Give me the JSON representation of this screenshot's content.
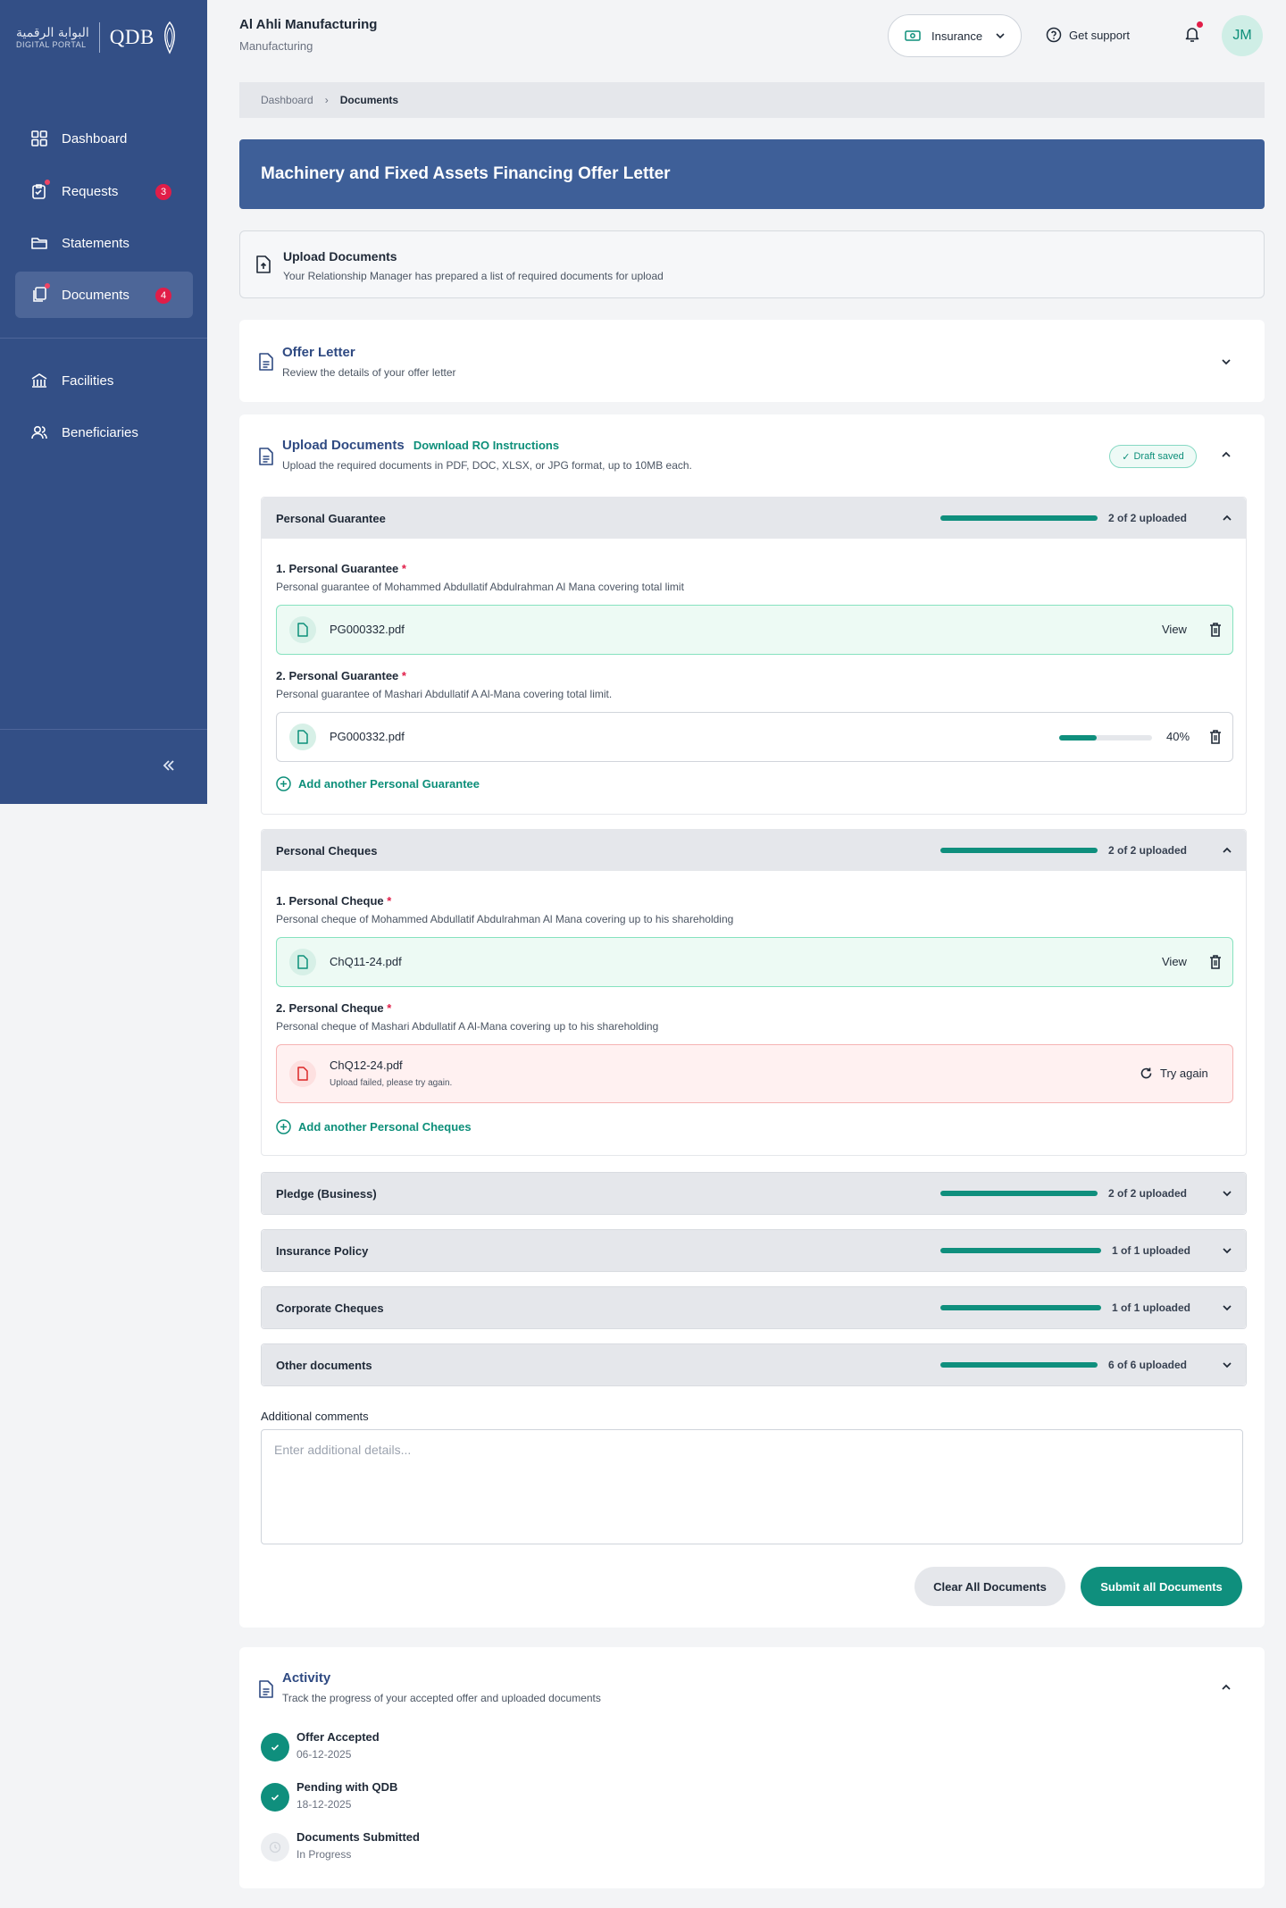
{
  "sidebar": {
    "logo_arabic": "البوابة الرقمية",
    "logo_english": "DIGITAL PORTAL",
    "logo_brand": "QDB",
    "items": [
      {
        "label": "Dashboard"
      },
      {
        "label": "Requests",
        "badge": "3"
      },
      {
        "label": "Statements"
      },
      {
        "label": "Documents",
        "badge": "4"
      },
      {
        "label": "Facilities"
      },
      {
        "label": "Beneficiaries"
      }
    ]
  },
  "header": {
    "company": "Al Ahli Manufacturing",
    "sector": "Manufacturing",
    "product_select": "Insurance",
    "support": "Get support",
    "avatar": "JM"
  },
  "breadcrumb": {
    "home": "Dashboard",
    "current": "Documents"
  },
  "page_title": "Machinery and Fixed Assets Financing Offer Letter",
  "upload_banner": {
    "title": "Upload Documents",
    "subtitle": "Your Relationship Manager has prepared a list of required documents for upload"
  },
  "offer_letter": {
    "title": "Offer Letter",
    "subtitle": "Review the details of your offer letter"
  },
  "upload_section": {
    "title": "Upload Documents",
    "link": "Download RO Instructions",
    "subtitle": "Upload the required documents in PDF, DOC, XLSX, or JPG format, up to 10MB each.",
    "draft": "Draft saved"
  },
  "sections": {
    "guarantee": {
      "title": "Personal Guarantee",
      "count": "2 of 2 uploaded",
      "progress": 1.0,
      "items": [
        {
          "title": "1. Personal Guarantee",
          "desc": "Personal guarantee of Mohammed Abdullatif Abdulrahman Al Mana covering total limit",
          "file": "PG000332.pdf",
          "action": "View"
        },
        {
          "title": "2. Personal Guarantee",
          "desc": "Personal guarantee of Mashari Abdullatif A Al-Mana covering total limit.",
          "file": "PG000332.pdf",
          "percent": "40%",
          "progress": 0.4
        }
      ],
      "add": "Add another Personal Guarantee"
    },
    "cheques": {
      "title": "Personal Cheques",
      "count": "2 of 2 uploaded",
      "progress": 1.0,
      "items": [
        {
          "title": "1. Personal Cheque",
          "desc": "Personal cheque of Mohammed Abdullatif Abdulrahman Al Mana covering up to his shareholding",
          "file": "ChQ11-24.pdf",
          "action": "View"
        },
        {
          "title": "2. Personal Cheque",
          "desc": "Personal cheque of Mashari Abdullatif A Al-Mana covering up to his shareholding",
          "file": "ChQ12-24.pdf",
          "error": "Upload failed, please try again.",
          "retry": "Try again"
        }
      ],
      "add": "Add another Personal Cheques"
    },
    "collapsed": [
      {
        "title": "Pledge (Business)",
        "count": "2 of 2 uploaded",
        "progress": 1.0
      },
      {
        "title": "Insurance Policy",
        "count": "1 of 1 uploaded",
        "progress": 1.0
      },
      {
        "title": "Corporate Cheques",
        "count": "1 of 1 uploaded",
        "progress": 1.0
      },
      {
        "title": "Other documents",
        "count": "6 of 6 uploaded",
        "progress": 1.0
      }
    ]
  },
  "comments": {
    "label": "Additional comments",
    "placeholder": "Enter additional details..."
  },
  "actions": {
    "clear": "Clear All Documents",
    "submit": "Submit all Documents"
  },
  "activity": {
    "title": "Activity",
    "subtitle": "Track the progress of your accepted offer and uploaded documents",
    "steps": [
      {
        "title": "Offer Accepted",
        "sub": "06-12-2025",
        "done": true
      },
      {
        "title": "Pending with QDB",
        "sub": "18-12-2025",
        "done": true
      },
      {
        "title": "Documents Submitted",
        "sub": "In Progress",
        "done": false
      }
    ]
  },
  "colors": {
    "sidebar": "#334f86",
    "accent": "#0f8f7d",
    "hero": "#3e5f98",
    "badge": "#e11d48"
  }
}
